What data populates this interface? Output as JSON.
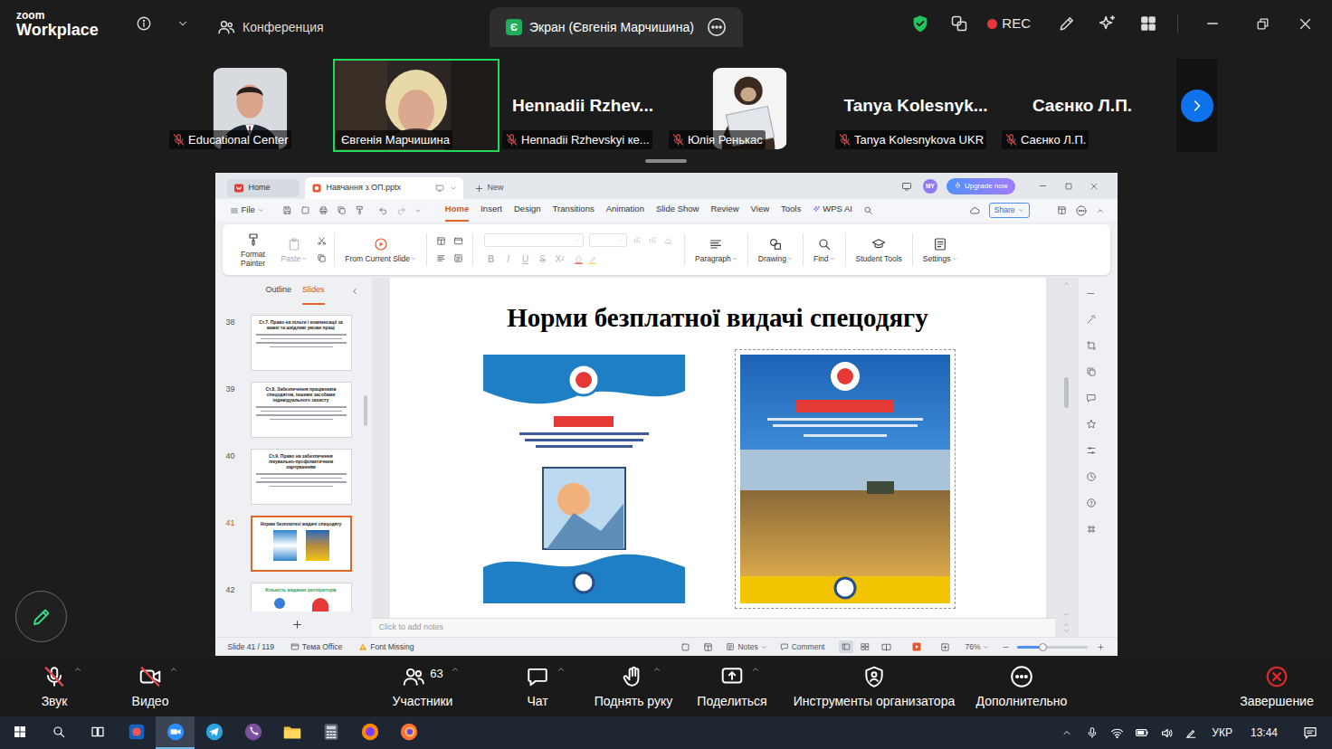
{
  "zoom_title_bar": {
    "logo_top": "zoom",
    "logo_bottom": "Workplace",
    "tabs": [
      {
        "label": "Конференция",
        "selected": false
      },
      {
        "label": "Экран (Євгенія Марчишина)",
        "selected": true
      }
    ],
    "tab_badge": "Є",
    "secure": true,
    "recording": {
      "label": "REC",
      "on": true
    }
  },
  "participants": [
    {
      "kind": "photo",
      "label": "Educational Center",
      "muted": true,
      "speaking": false
    },
    {
      "kind": "video",
      "label": "Євгенія Марчишина",
      "muted": false,
      "speaking": true
    },
    {
      "kind": "name",
      "title": "Hennadii Rzhev...",
      "label": "Hennadii Rzhevskyi ке...",
      "muted": true,
      "speaking": false
    },
    {
      "kind": "photo",
      "label": "Юлія Ренькас",
      "muted": true,
      "speaking": false
    },
    {
      "kind": "name",
      "title": "Tanya Kolesnyk...",
      "label": "Tanya Kolesnykova UKR",
      "muted": true,
      "speaking": false
    },
    {
      "kind": "name",
      "title": "Саєнко Л.П.",
      "label": "Саєнко Л.П.",
      "muted": true,
      "speaking": false
    }
  ],
  "shared_app": {
    "tabs": [
      {
        "label": "Home",
        "selected": false
      },
      {
        "label": "Навчання з ОП.pptx",
        "selected": true
      }
    ],
    "new_tab": "New",
    "avatar": "MY",
    "upgrade": "Upgrade now",
    "file_menu": "File",
    "menu": [
      {
        "label": "Home",
        "selected": true
      },
      {
        "label": "Insert",
        "selected": false
      },
      {
        "label": "Design",
        "selected": false
      },
      {
        "label": "Transitions",
        "selected": false
      },
      {
        "label": "Animation",
        "selected": false
      },
      {
        "label": "Slide Show",
        "selected": false
      },
      {
        "label": "Review",
        "selected": false
      },
      {
        "label": "View",
        "selected": false
      },
      {
        "label": "Tools",
        "selected": false
      },
      {
        "label": "WPS AI",
        "selected": false
      }
    ],
    "share": "Share",
    "ribbon": [
      {
        "label": "Format Painter",
        "disabled": false,
        "menu": false
      },
      {
        "label": "Paste",
        "disabled": true,
        "menu": true
      },
      {
        "label": "From Current Slide",
        "disabled": false,
        "menu": true
      },
      {
        "label": "Paragraph",
        "disabled": false,
        "menu": true
      },
      {
        "label": "Drawing",
        "disabled": false,
        "menu": true
      },
      {
        "label": "Find",
        "disabled": false,
        "menu": true
      },
      {
        "label": "Student Tools",
        "disabled": false,
        "menu": false
      },
      {
        "label": "Settings",
        "disabled": false,
        "menu": true
      }
    ],
    "font_buttons": [
      {
        "label": "B",
        "disabled": true
      },
      {
        "label": "I",
        "disabled": true
      },
      {
        "label": "U",
        "disabled": true
      },
      {
        "label": "S",
        "disabled": true
      },
      {
        "label": "X²",
        "disabled": true
      }
    ],
    "panel_tabs": [
      {
        "label": "Outline",
        "selected": false
      },
      {
        "label": "Slides",
        "selected": true
      }
    ],
    "slides": [
      {
        "number": "38",
        "title": "Ст.7. Право на пільги і компенсації за важкі та шкідливі умови праці",
        "kind": "text",
        "selected": false
      },
      {
        "number": "39",
        "title": "Ст.8. Забезпечення працівників спецодягом, іншими засобами індивідуального захисту",
        "kind": "text",
        "selected": false
      },
      {
        "number": "40",
        "title": "Ст.9. Право на забезпечення лікувально-профілактичним харчуванням",
        "kind": "text",
        "selected": false
      },
      {
        "number": "41",
        "title": "Норми безплатної видачі спецодягу",
        "kind": "covers",
        "selected": true
      },
      {
        "number": "42",
        "title": "Кількість виданих респіраторів",
        "kind": "items",
        "selected": false
      }
    ],
    "slide": {
      "title": "Норми безплатної видачі спецодягу",
      "images": [
        {
          "kind": "fishing-cover",
          "selected": false
        },
        {
          "kind": "field-cover",
          "selected": true
        }
      ]
    },
    "notes_placeholder": "Click to add notes",
    "status": {
      "slide": "Slide 41 / 119",
      "theme": "Тема Office",
      "font": "Font Missing",
      "notes": "Notes",
      "comment": "Comment",
      "zoom": "76%",
      "zoom_level": 0.38
    }
  },
  "meeting_toolbar": [
    {
      "label": "Звук",
      "off": true,
      "menu": true
    },
    {
      "label": "Видео",
      "off": true,
      "menu": true
    },
    {
      "label": "Участники",
      "count": "63",
      "off": false,
      "menu": true
    },
    {
      "label": "Чат",
      "off": false,
      "menu": true
    },
    {
      "label": "Поднять руку",
      "off": false,
      "menu": true
    },
    {
      "label": "Поделиться",
      "off": false,
      "menu": true
    },
    {
      "label": "Инструменты организатора",
      "off": false,
      "menu": false
    },
    {
      "label": "Дополнительно",
      "off": false,
      "menu": false
    },
    {
      "label": "Завершение",
      "off": false,
      "menu": false
    }
  ],
  "taskbar": {
    "apps": [
      {
        "selected": false
      },
      {
        "selected": false
      },
      {
        "selected": false
      },
      {
        "selected": false
      },
      {
        "selected": true
      },
      {
        "selected": false
      },
      {
        "selected": false
      },
      {
        "selected": false
      },
      {
        "selected": false
      },
      {
        "selected": false
      },
      {
        "selected": false
      }
    ],
    "language": "УКР",
    "time": "13:44"
  }
}
